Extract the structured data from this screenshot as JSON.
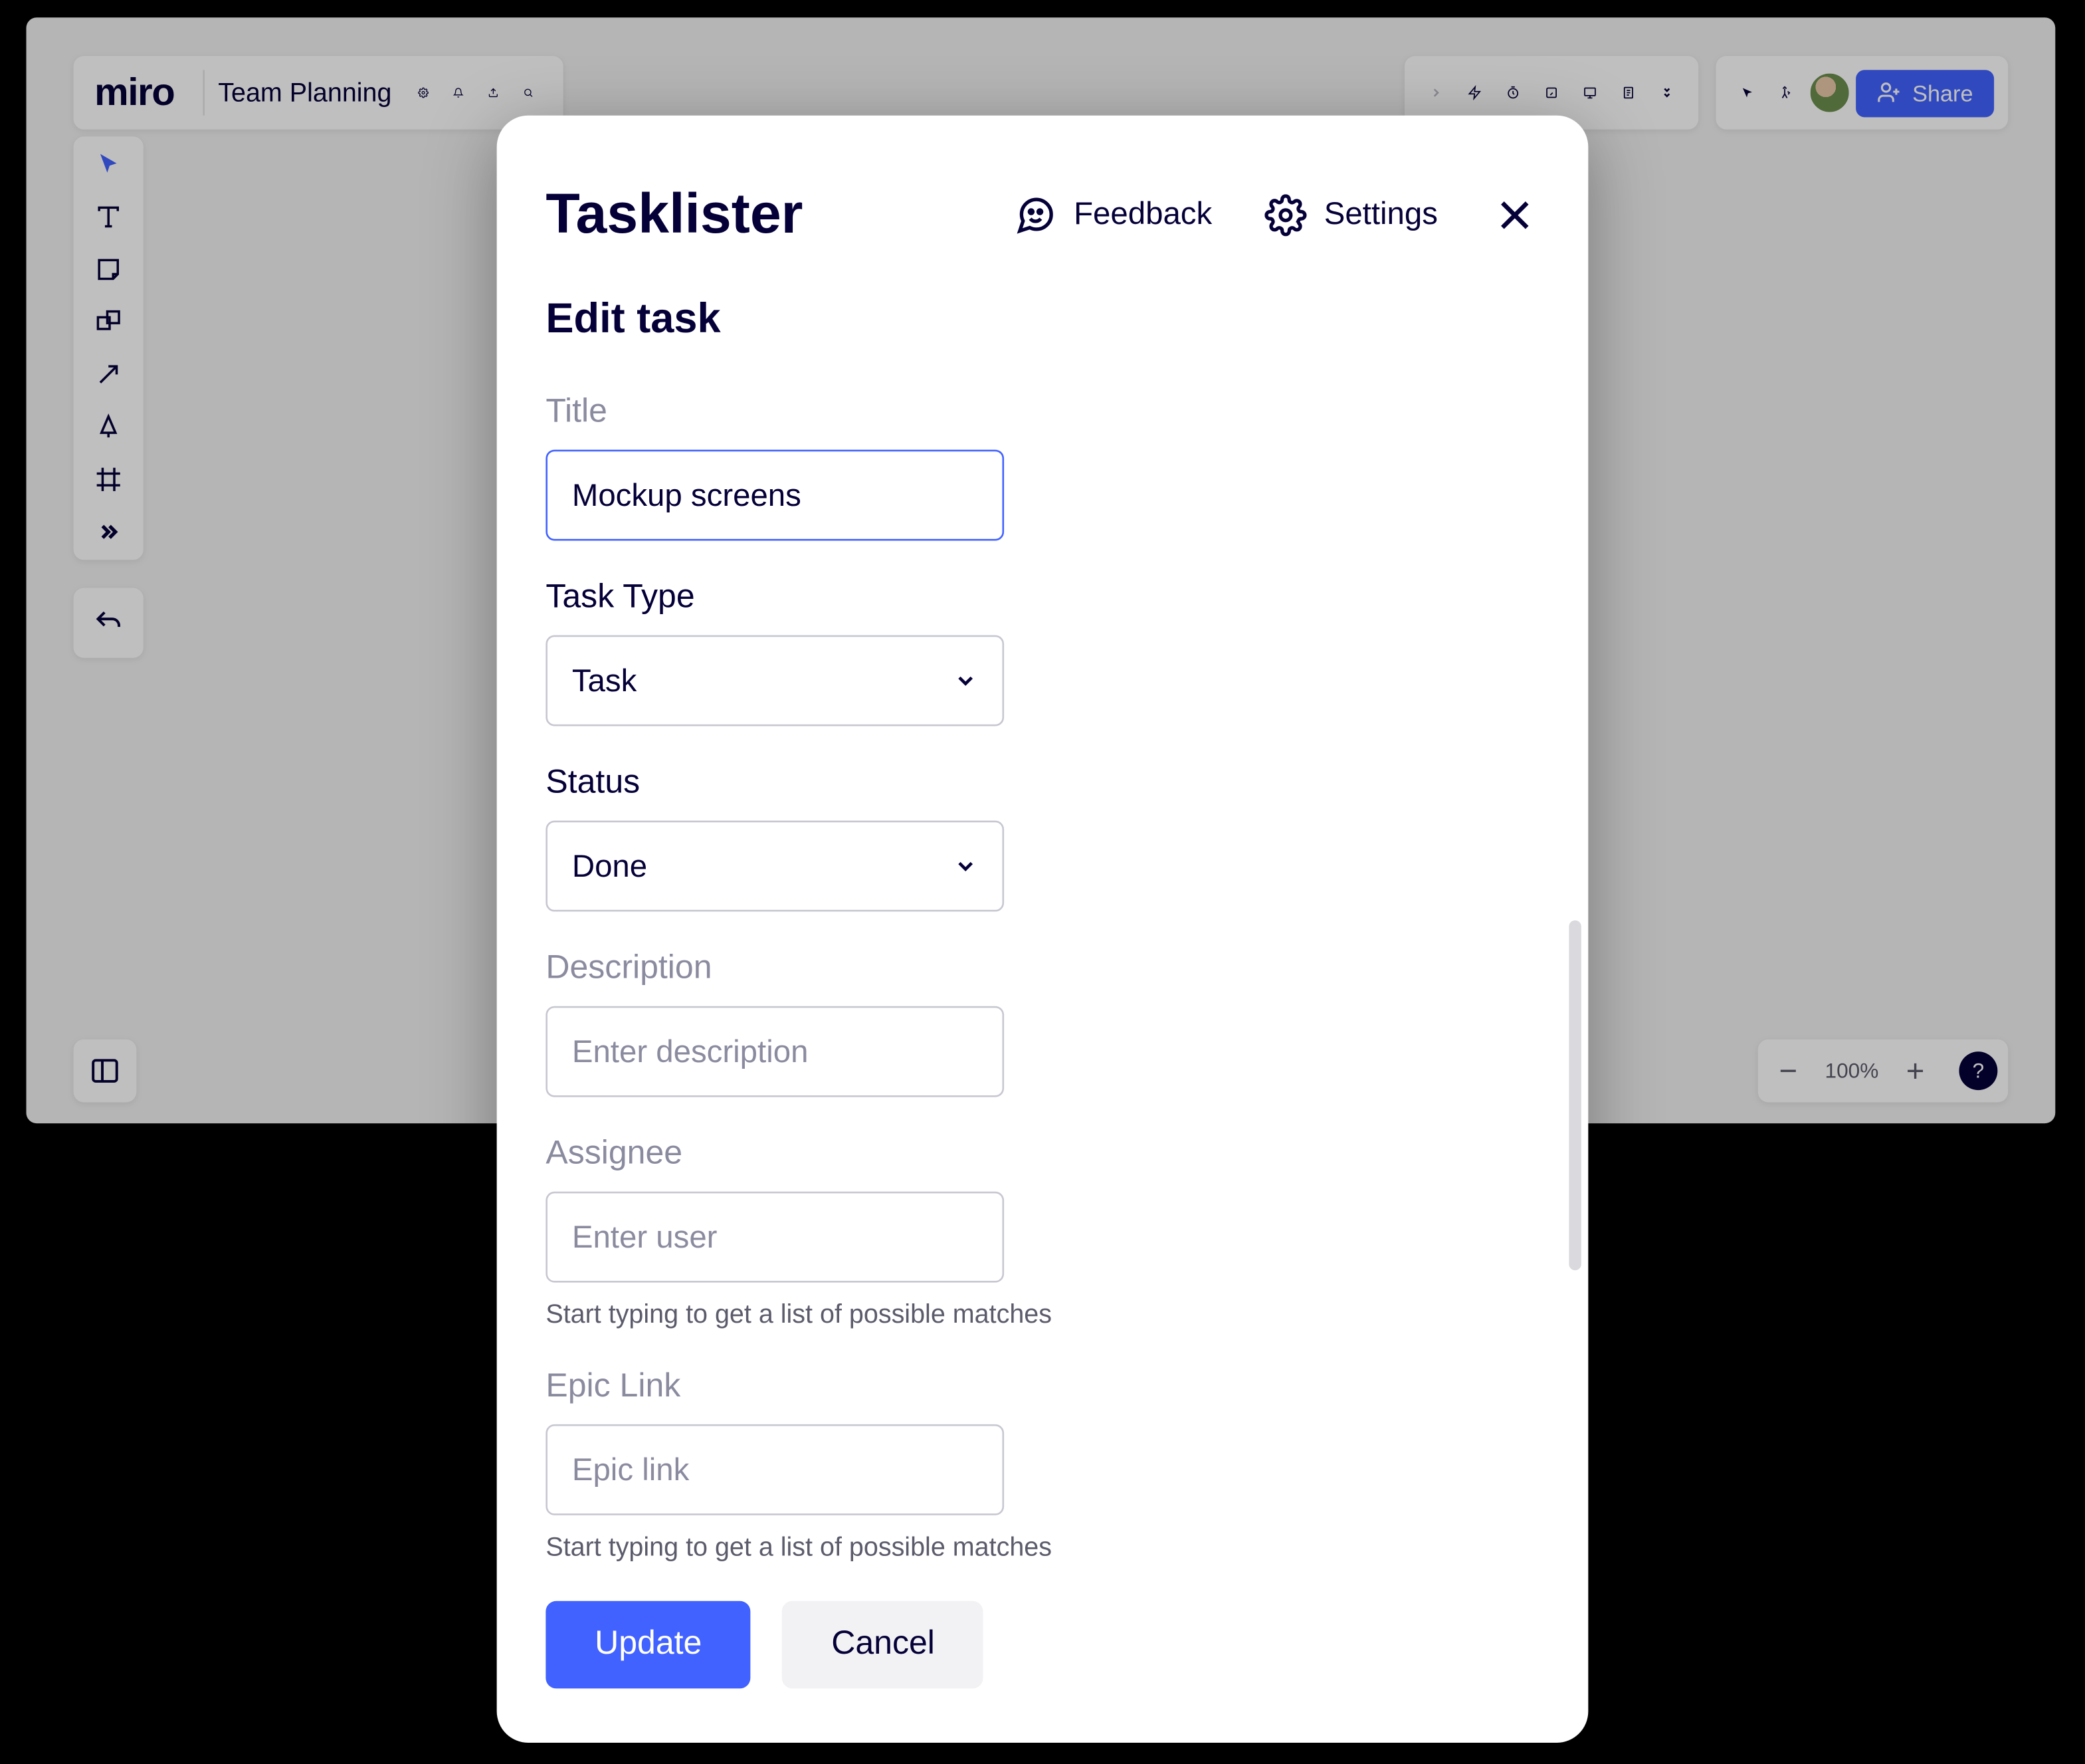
{
  "app": {
    "logo": "miro",
    "board_name": "Team Planning",
    "zoom": "100%",
    "share_label": "Share"
  },
  "modal": {
    "title": "Tasklister",
    "feedback_label": "Feedback",
    "settings_label": "Settings",
    "subtitle": "Edit task",
    "fields": {
      "title": {
        "label": "Title",
        "value": "Mockup screens"
      },
      "task_type": {
        "label": "Task Type",
        "value": "Task"
      },
      "status": {
        "label": "Status",
        "value": "Done"
      },
      "description": {
        "label": "Description",
        "placeholder": "Enter description"
      },
      "assignee": {
        "label": "Assignee",
        "placeholder": "Enter user",
        "help": "Start typing to get a list of possible matches"
      },
      "epic_link": {
        "label": "Epic Link",
        "placeholder": "Epic link",
        "help": "Start typing to get a list of possible matches"
      }
    },
    "buttons": {
      "primary": "Update",
      "secondary": "Cancel"
    }
  }
}
